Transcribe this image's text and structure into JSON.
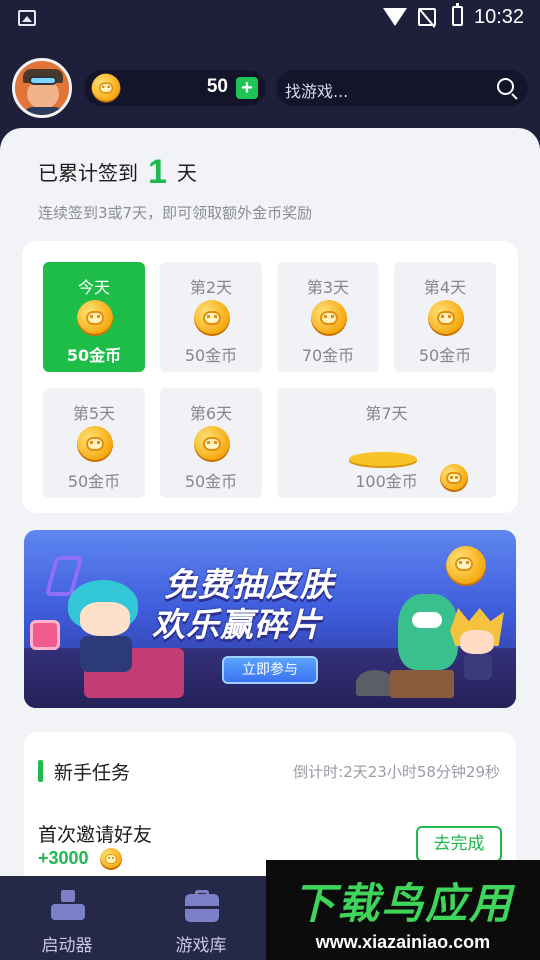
{
  "status_bar": {
    "time": "10:32"
  },
  "header": {
    "coin_balance": "50",
    "add_label": "+",
    "search_placeholder": "找游戏..."
  },
  "checkin": {
    "prefix": "已累计签到",
    "days_count": "1",
    "suffix": "天",
    "subtitle": "连续签到3或7天，即可领取额外金币奖励",
    "days": [
      {
        "label": "今天",
        "reward": "50金币",
        "state": "today"
      },
      {
        "label": "第2天",
        "reward": "50金币",
        "state": "pending"
      },
      {
        "label": "第3天",
        "reward": "70金币",
        "state": "pending"
      },
      {
        "label": "第4天",
        "reward": "50金币",
        "state": "pending"
      },
      {
        "label": "第5天",
        "reward": "50金币",
        "state": "pending"
      },
      {
        "label": "第6天",
        "reward": "50金币",
        "state": "pending"
      },
      {
        "label": "第7天",
        "reward": "100金币",
        "state": "pending"
      }
    ]
  },
  "banner": {
    "line1": "免费抽皮肤",
    "line2": "欢乐赢碎片",
    "button": "立即参与"
  },
  "tasks": {
    "title": "新手任务",
    "countdown": "倒计时:2天23小时58分钟29秒",
    "items": [
      {
        "name": "首次邀请好友",
        "reward": "+3000",
        "action": "去完成"
      }
    ]
  },
  "tabbar": {
    "tabs": [
      {
        "label": "启动器",
        "icon": "launcher-icon"
      },
      {
        "label": "游戏库",
        "icon": "game-library-icon"
      }
    ]
  },
  "watermark": {
    "title": "下载鸟应用",
    "url": "www.xiazainiao.com"
  },
  "colors": {
    "accent_green": "#1fb84e",
    "header_bg": "#1e1f3b",
    "page_bg": "#f2f3f7"
  }
}
